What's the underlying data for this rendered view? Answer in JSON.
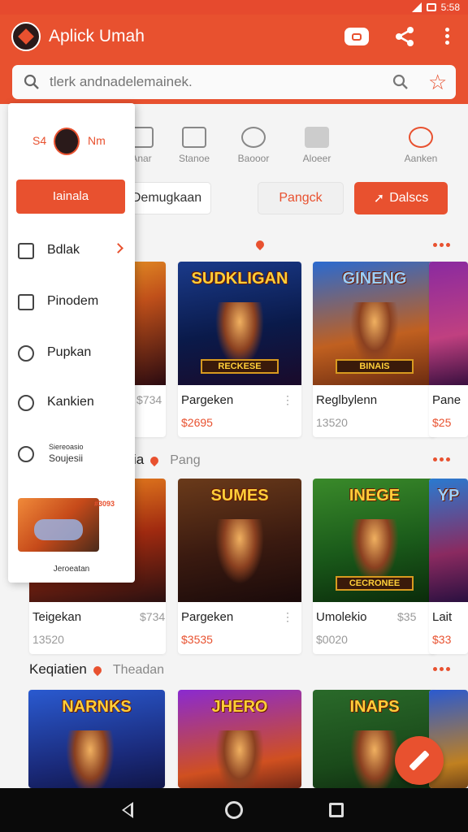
{
  "app": {
    "title": "Aplick Umah",
    "status_time": "5:58"
  },
  "search": {
    "placeholder": "tlerk andnadelemainek."
  },
  "categories": [
    {
      "label": "Anar"
    },
    {
      "label": "Stanoe"
    },
    {
      "label": "Baooor"
    },
    {
      "label": "Aloeer"
    },
    {
      "label": "Aanken"
    }
  ],
  "filters": {
    "chip_1": "Demugkaan",
    "chip_2": "Pangck",
    "chip_3": "Dalscs"
  },
  "drawer": {
    "head_left": "S4",
    "head_right": "Nm",
    "primary_button": "Iainala",
    "items": [
      {
        "label": "Bdlak"
      },
      {
        "label": "Pinodem"
      },
      {
        "label": "Pupkan"
      },
      {
        "label": "Kankien"
      }
    ],
    "mini_line1": "Siereoasio",
    "mini_line2": "Soujesii",
    "card_badge": "#3093",
    "footer": "Jeroeatan"
  },
  "sections": [
    {
      "title": "",
      "subtitle": "",
      "cards": [
        {
          "art_title": "",
          "badge": "",
          "name": "",
          "price": "$734"
        },
        {
          "art_title": "SUDKLIGAN",
          "badge": "RECKESE",
          "name": "Pargeken",
          "price": "$2695"
        },
        {
          "art_title": "GINENG",
          "badge": "BINAIS",
          "name": "Reglbylenn",
          "price": "13520"
        },
        {
          "art_title": "",
          "badge": "",
          "name": "Pane",
          "price": "$25"
        }
      ]
    },
    {
      "title": "ia",
      "subtitle": "Pang",
      "cards": [
        {
          "art_title": "",
          "badge": "",
          "name": "Teigekan",
          "price": "13520"
        },
        {
          "art_title": "SUMES",
          "badge": "",
          "name": "Pargeken",
          "price": "$3535"
        },
        {
          "art_title": "INEGE",
          "badge": "CECRONEE",
          "name": "Umolekio",
          "price": "$0020"
        },
        {
          "art_title": "YP",
          "badge": "",
          "name": "Lait",
          "price": "$33"
        }
      ]
    },
    {
      "title": "Keqiatien",
      "subtitle": "Theadan",
      "cards": [
        {
          "art_title": "NARNKS"
        },
        {
          "art_title": "JHERO"
        },
        {
          "art_title": "INAPS"
        },
        {
          "art_title": ""
        }
      ]
    }
  ],
  "card_meta": {
    "card0_right": "$734",
    "card4_right": "$734",
    "card6_right": "$35"
  },
  "colors": {
    "accent": "#e8512f",
    "background": "#f4f4f4"
  },
  "icons": {
    "share": "share-icon",
    "more": "more-vert-icon",
    "star": "star-icon",
    "fab": "edit-icon"
  }
}
